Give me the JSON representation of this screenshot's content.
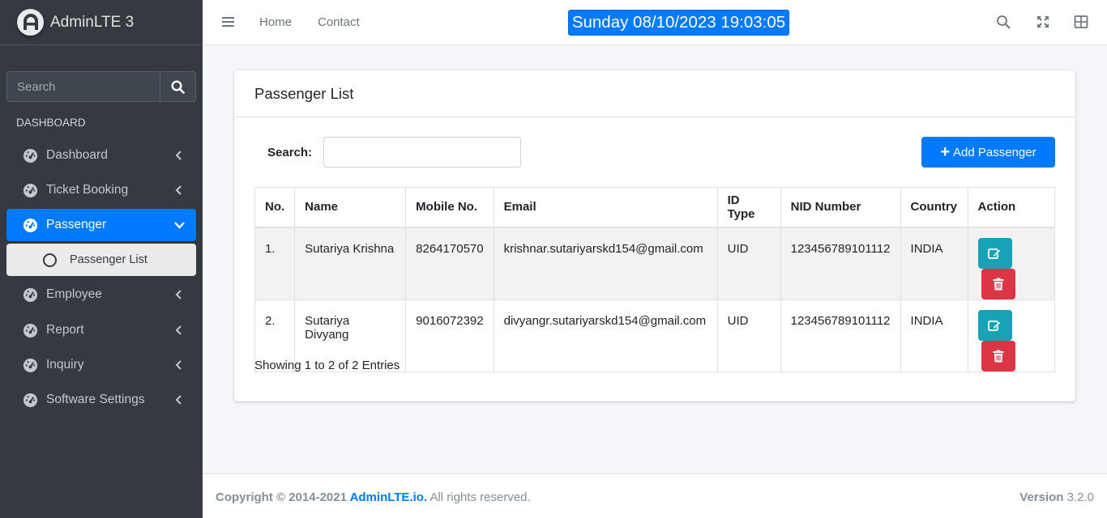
{
  "brand": {
    "name": "AdminLTE 3"
  },
  "sidebar": {
    "search_placeholder": "Search",
    "header": "DASHBOARD",
    "items": [
      {
        "label": "Dashboard"
      },
      {
        "label": "Ticket Booking"
      },
      {
        "label": "Passenger"
      },
      {
        "label": "Employee"
      },
      {
        "label": "Report"
      },
      {
        "label": "Inquiry"
      },
      {
        "label": "Software Settings"
      }
    ],
    "subitem": {
      "label": "Passenger List"
    }
  },
  "topbar": {
    "links": [
      "Home",
      "Contact"
    ],
    "clock": "Sunday 08/10/2023 19:03:05"
  },
  "card": {
    "title": "Passenger List",
    "search_label": "Search:",
    "add_button": "Add Passenger",
    "columns": [
      "No.",
      "Name",
      "Mobile No.",
      "Email",
      "ID Type",
      "NID Number",
      "Country",
      "Action"
    ],
    "rows": [
      {
        "no": "1.",
        "name": "Sutariya Krishna",
        "mobile": "8264170570",
        "email": "krishnar.sutariyarskd154@gmail.com",
        "id_type": "UID",
        "nid": "123456789101112",
        "country": "INDIA"
      },
      {
        "no": "2.",
        "name": "Sutariya Divyang",
        "mobile": "9016072392",
        "email": "divyangr.sutariyarskd154@gmail.com",
        "id_type": "UID",
        "nid": "123456789101112",
        "country": "INDIA"
      }
    ],
    "entries": "Showing 1 to 2 of 2 Entries"
  },
  "footer": {
    "copyright": "Copyright © 2014-2021 ",
    "brand_link": "AdminLTE.io.",
    "rights": " All rights reserved.",
    "version_label": "Version",
    "version": " 3.2.0"
  },
  "colors": {
    "primary": "#007bff",
    "info": "#17a2b8",
    "danger": "#dc3545",
    "sidebar": "#343a40"
  }
}
